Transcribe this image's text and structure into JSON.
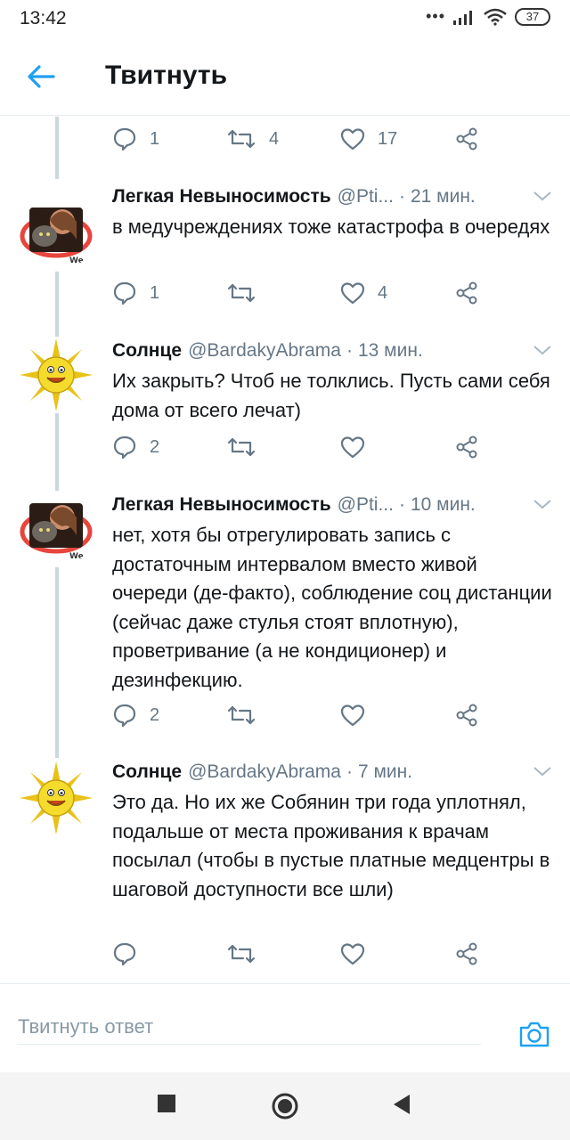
{
  "status_bar": {
    "time": "13:42",
    "battery": "37"
  },
  "header": {
    "title": "Твитнуть"
  },
  "top_actions": {
    "reply_count": "1",
    "retweet_count": "4",
    "like_count": "17"
  },
  "tweets": [
    {
      "name": "Легкая Невыносимость",
      "handle": "@Pti...",
      "time": "21 мин.",
      "text": "в медучреждениях тоже катастрофа в очередях",
      "reply_count": "1",
      "retweet_count": "",
      "like_count": "4"
    },
    {
      "name": "Солнце",
      "handle": "@BardakyAbrama",
      "time": "13 мин.",
      "text": "Их закрыть? Чтоб не толклись. Пусть сами себя дома от всего лечат)",
      "reply_count": "2",
      "retweet_count": "",
      "like_count": ""
    },
    {
      "name": "Легкая Невыносимость",
      "handle": "@Pti...",
      "time": "10 мин.",
      "text": "нет, хотя бы отрегулировать запись с достаточным интервалом вместо живой очереди (де-факто), соблюдение соц дистанции (сейчас даже стулья стоят вплотную), проветривание (а не кондиционер) и дезинфекцию.",
      "reply_count": "2",
      "retweet_count": "",
      "like_count": ""
    },
    {
      "name": "Солнце",
      "handle": "@BardakyAbrama",
      "time": "7 мин.",
      "text": "Это да. Но их же Собянин три года уплотнял, подальше от места проживания к врачам посылал (чтобы в пустые платные медцентры в шаговой доступности все шли)",
      "reply_count": "",
      "retweet_count": "",
      "like_count": ""
    }
  ],
  "reply_bar": {
    "placeholder": "Твитнуть ответ"
  },
  "icons": {
    "back": "arrow-left-icon",
    "reply": "speech-bubble-icon",
    "retweet": "retweet-icon",
    "like": "heart-icon",
    "share": "share-icon",
    "caret": "chevron-down-icon",
    "camera": "camera-icon",
    "nav_recents": "square-icon",
    "nav_home": "circle-icon",
    "nav_back": "triangle-left-icon"
  },
  "colors": {
    "accent": "#1da1f2",
    "secondary_text": "#657786",
    "thread_line": "#ccd6dd"
  }
}
